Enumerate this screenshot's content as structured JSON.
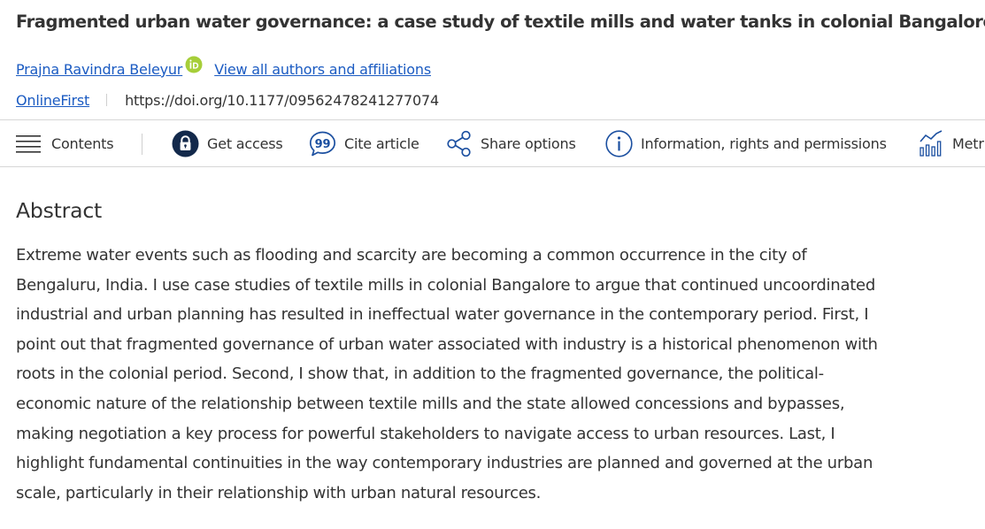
{
  "article": {
    "title": "Fragmented urban water governance: a case study of textile mills and water tanks in colonial Bangalore"
  },
  "authors": {
    "name": "Prajna Ravindra Beleyur",
    "orcid_icon": "orcid-icon",
    "view_all": "View all authors and affiliations"
  },
  "meta": {
    "status": "OnlineFirst",
    "doi": "https://doi.org/10.1177/09562478241277074"
  },
  "toolbar": {
    "contents": "Contents",
    "get_access": "Get access",
    "cite_article": "Cite article",
    "share_options": "Share options",
    "info_rights": "Information, rights and permissions",
    "metrics": "Metrics"
  },
  "abstract": {
    "heading": "Abstract",
    "body": "Extreme water events such as flooding and scarcity are becoming a common occurrence in the city of Bengaluru, India. I use case studies of textile mills in colonial Bangalore to argue that continued uncoordinated industrial and urban planning has resulted in ineffectual water governance in the contemporary period. First, I point out that fragmented governance of urban water associated with industry is a historical phenomenon with roots in the colonial period. Second, I show that, in addition to the fragmented governance, the political-economic nature of the relationship between textile mills and the state allowed concessions and bypasses, making negotiation a key process for powerful stakeholders to navigate access to urban resources. Last, I highlight fundamental continuities in the way contemporary industries are planned and governed at the urban scale, particularly in their relationship with urban natural resources."
  },
  "colors": {
    "link": "#1b5bc2",
    "text": "#333333",
    "orcid": "#a6ce39",
    "lock_badge": "#13294b",
    "icon_blue": "#1b4fa0"
  }
}
